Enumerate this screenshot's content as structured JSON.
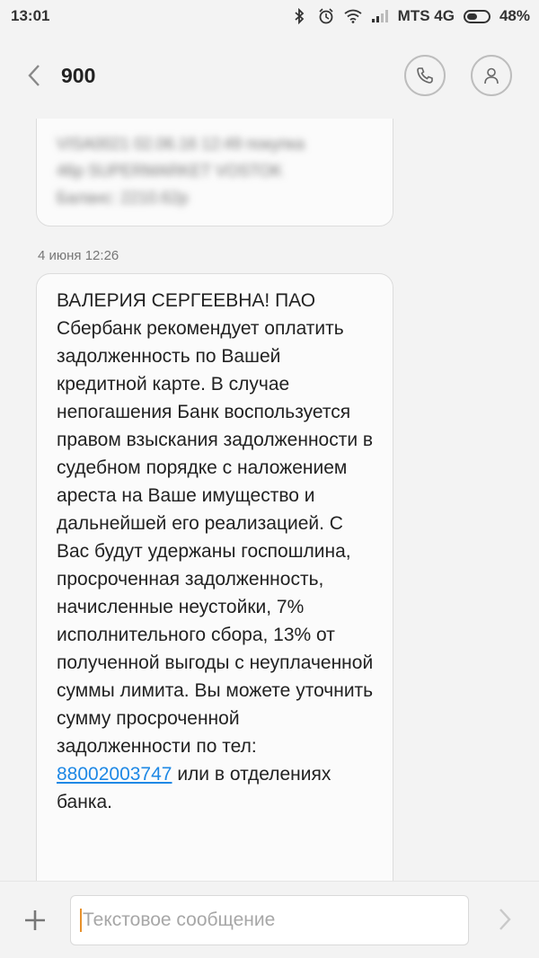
{
  "status": {
    "time": "13:01",
    "carrier": "MTS 4G",
    "battery": "48%"
  },
  "header": {
    "title": "900",
    "icons": [
      "back-chevron",
      "phone",
      "contact"
    ]
  },
  "messages": {
    "previous": {
      "lines": [
        "VISA0021 02.06.16 12:49 покупка",
        "46р SUPERMARKET VOSTOK",
        "Баланс: 2210.62р"
      ]
    },
    "timestamp": "4 июня 12:26",
    "main": {
      "text_before": "ВАЛЕРИЯ СЕРГЕЕВНА! ПАО Сбербанк рекомендует оплатить задолженность по Вашей кредитной карте. В случае непогашения Банк воспользуется правом взыскания задолженности в судебном порядке с наложением ареста на Ваше имущество и дальнейшей его реализацией. С Вас будут удержаны госпошлина, просроченная задолженность, начисленные неустойки, 7% исполнительного сбора, 13% от полученной выгоды с неуплаченной суммы лимита. Вы можете уточнить сумму просроченной задолженности по тел: ",
      "phone": "88002003747",
      "text_after": " или в отделениях банка."
    }
  },
  "composer": {
    "placeholder": "Текстовое сообщение",
    "value": ""
  },
  "colors": {
    "accent": "#1e88e5",
    "cursor": "#e8912b",
    "bubble": "#fbfbfb",
    "background": "#f3f3f3"
  }
}
